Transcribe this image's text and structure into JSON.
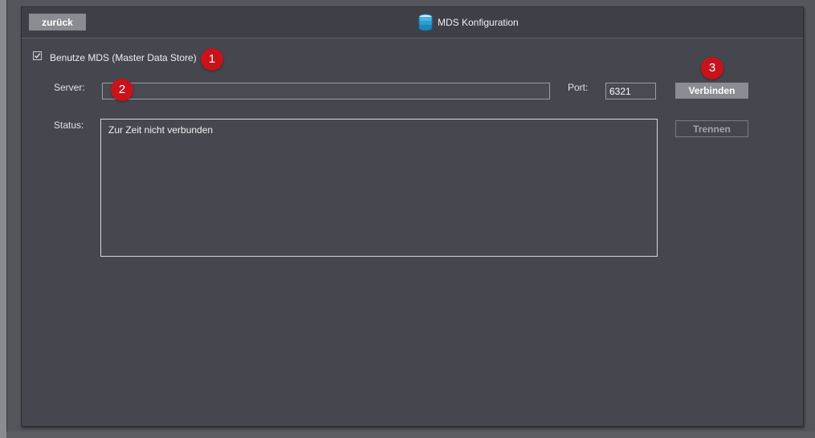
{
  "header": {
    "back_label": "zurück",
    "title": "MDS Konfiguration",
    "title_icon": "database-icon"
  },
  "settings": {
    "use_mds_label": "Benutze MDS (Master Data Store)",
    "use_mds_checked": true,
    "server_label": "Server:",
    "server_value": "",
    "port_label": "Port:",
    "port_value": "6321",
    "status_label": "Status:",
    "status_text": "Zur Zeit nicht verbunden",
    "connect_label": "Verbinden",
    "disconnect_label": "Trennen"
  },
  "annotations": {
    "badge_1": "1",
    "badge_2": "2",
    "badge_3": "3",
    "badge_color": "#c8131a"
  }
}
